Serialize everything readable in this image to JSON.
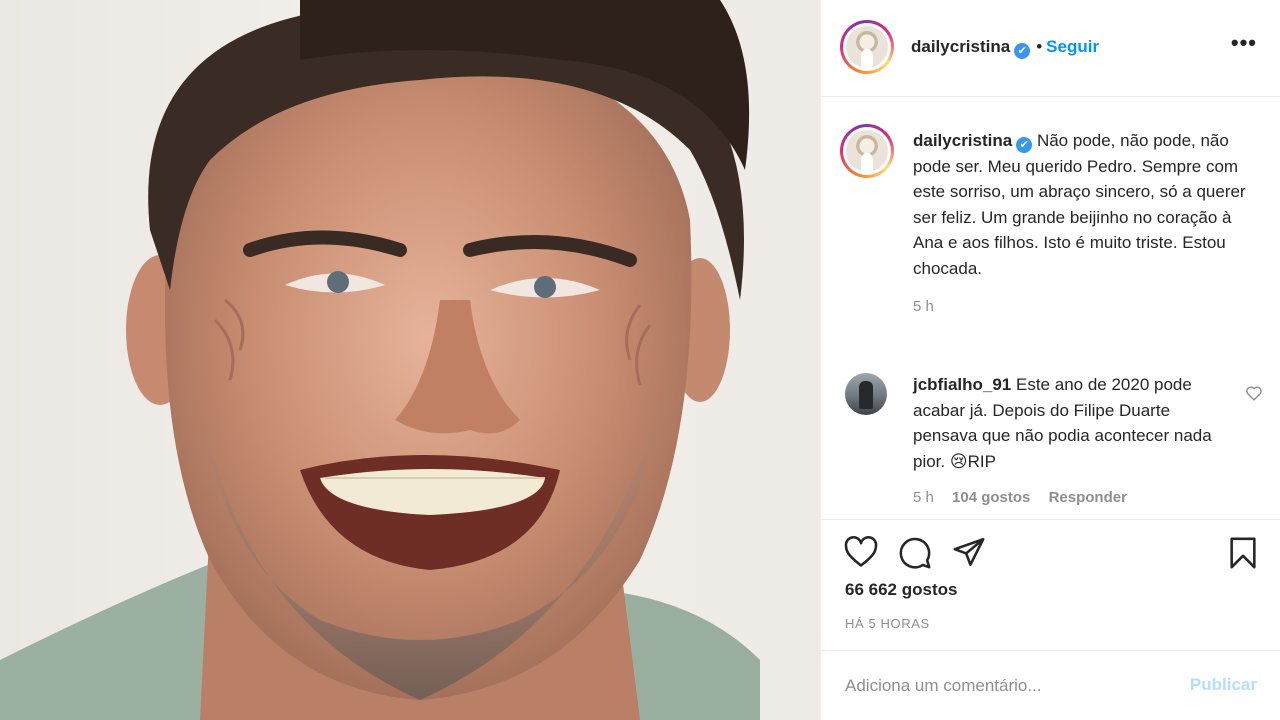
{
  "post": {
    "username": "dailycristina",
    "follow_label": "Seguir",
    "separator": "•",
    "verified_mark": "✔",
    "more_label": "•••"
  },
  "caption": {
    "username": "dailycristina",
    "text": "Não pode, não pode, não pode ser. Meu querido Pedro. Sempre com este sorriso, um abraço sincero, só a querer ser feliz. Um grande beijinho no coração à Ana e aos filhos. Isto é muito triste. Estou chocada.",
    "time": "5 h"
  },
  "comment": {
    "username": "jcbfialho_91",
    "text": "Este ano de 2020 pode acabar já. Depois do Filipe Duarte pensava que não podia acontecer nada pior. 😢RIP",
    "time": "5 h",
    "likes": "104 gostos",
    "reply_label": "Responder"
  },
  "actions": {
    "likes_count": "66 662 gostos",
    "time_ago": "HÁ 5 HORAS",
    "comment_placeholder": "Adiciona um comentário...",
    "publish_label": "Publicar"
  },
  "icons": {
    "heart": "heart-icon",
    "comment": "comment-icon",
    "share": "share-icon",
    "bookmark": "bookmark-icon",
    "small_heart": "heart-icon"
  },
  "colors": {
    "link": "#0095f6",
    "verified": "#3897f0",
    "muted": "#8e8e8e",
    "publish_disabled": "#b2dffc"
  }
}
